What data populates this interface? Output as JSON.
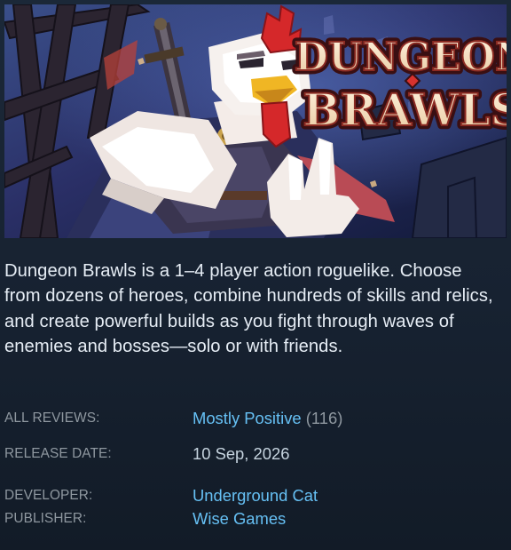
{
  "hero_image": {
    "logo_word_1": "DUNGEON",
    "logo_word_2": "BRAWLS"
  },
  "description": "Dungeon Brawls is a 1–4 player action roguelike. Choose from dozens of heroes, combine hundreds of skills and relics, and create powerful builds as you fight through waves of enemies and bosses—solo or with friends.",
  "info": {
    "reviews": {
      "label": "ALL REVIEWS:",
      "summary": "Mostly Positive",
      "count": "(116)"
    },
    "release": {
      "label": "RELEASE DATE:",
      "value": "10 Sep, 2026"
    },
    "developer": {
      "label": "DEVELOPER:",
      "value": "Underground Cat"
    },
    "publisher": {
      "label": "PUBLISHER:",
      "value": "Wise Games"
    }
  },
  "colors": {
    "background": "#1b2838",
    "description_text": "#e6edf5",
    "label_text": "#8f98a0",
    "link": "#66c0f4",
    "value_text": "#c6d4df"
  }
}
